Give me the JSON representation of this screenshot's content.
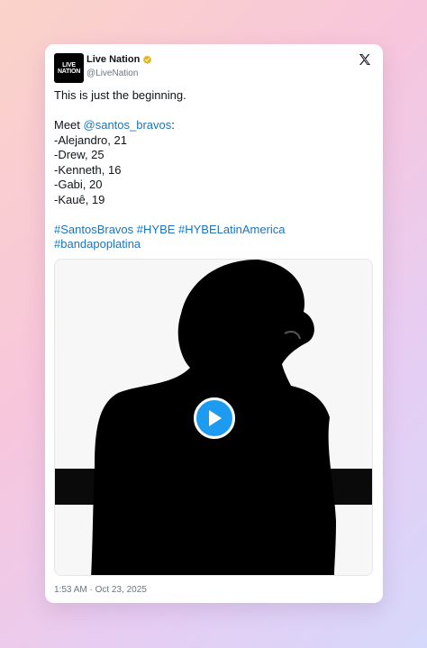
{
  "post": {
    "author_name": "Live Nation",
    "author_handle": "@LiveNation",
    "avatar_line1": "LIVE",
    "avatar_line2": "NATION",
    "text_line1": "This is just the beginning.",
    "meet_prefix": "Meet ",
    "mention": "@santos_bravos",
    "meet_suffix": ":",
    "members": [
      "-Alejandro, 21",
      "-Drew, 25",
      "-Kenneth, 16",
      "-Gabi, 20",
      "-Kauê, 19"
    ],
    "hashtags_line1": "#SantosBravos #HYBE #HYBELatinAmerica",
    "hashtags_line2": "#bandapoplatina",
    "timestamp": "1:53 AM · Oct 23, 2025"
  },
  "icons": {
    "verified": "verified-badge-icon",
    "platform": "x-logo-icon",
    "play": "play-icon"
  },
  "colors": {
    "link": "#1d74b8",
    "play_button": "#1d9bf0",
    "verified_badge": "#e8b321"
  }
}
